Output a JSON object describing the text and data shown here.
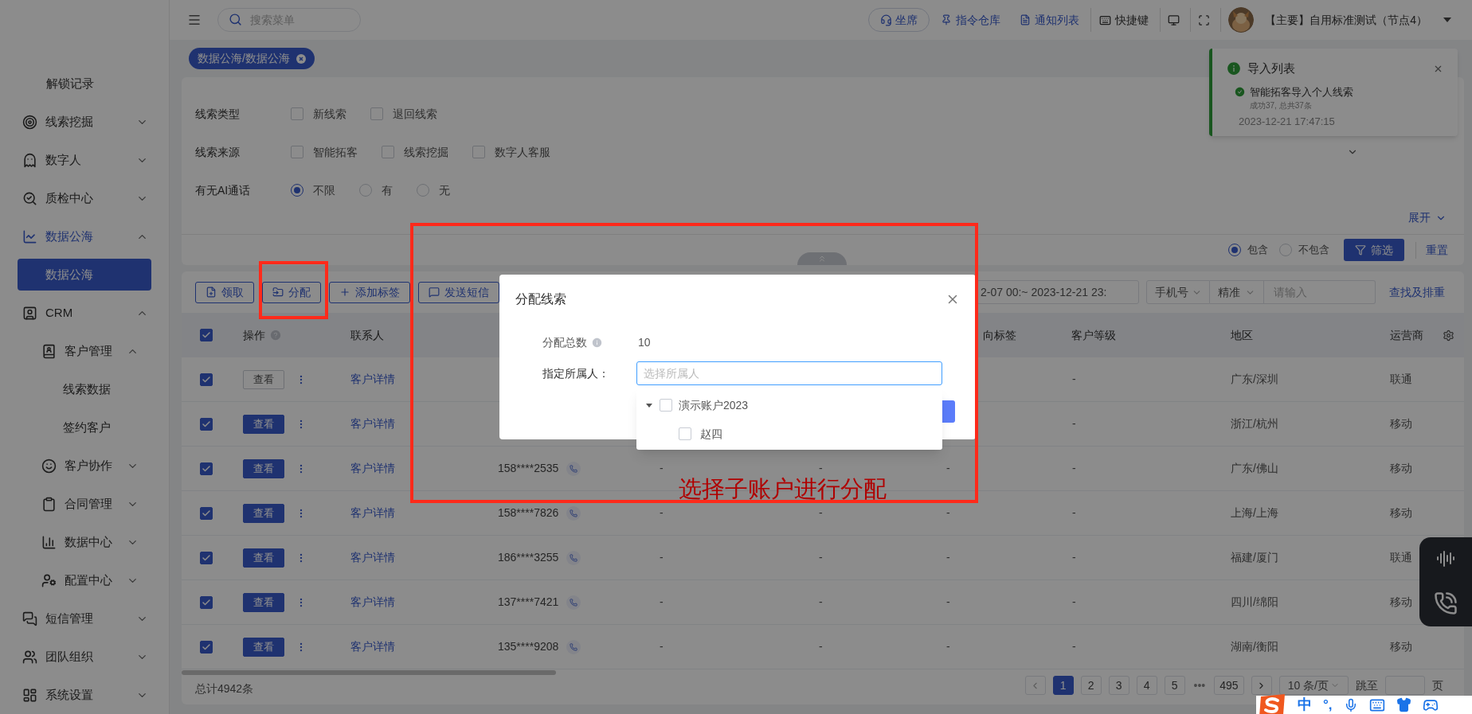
{
  "topbar": {
    "search": {
      "placeholder": "搜索菜单"
    },
    "actions": [
      {
        "kind": "pill",
        "label": "坐席"
      },
      {
        "kind": "link",
        "label": "指令仓库"
      },
      {
        "kind": "link",
        "label": "通知列表"
      },
      {
        "kind": "plain",
        "label": "快捷键"
      },
      {
        "kind": "icon"
      },
      {
        "kind": "icon"
      }
    ],
    "user": "【主要】自用标准测试（节点4）"
  },
  "tabs": [
    {
      "label": "数据公海/数据公海",
      "selected": true
    }
  ],
  "sidebar": {
    "items": [
      {
        "label": "解锁记录",
        "selected": false
      },
      {
        "label": "线索挖掘",
        "expanded": false,
        "selected": false
      },
      {
        "label": "数字人",
        "expanded": false,
        "selected": false
      },
      {
        "label": "质检中心",
        "expanded": false,
        "selected": false
      },
      {
        "label": "数据公海",
        "expanded": true,
        "selected": true,
        "children": [
          {
            "label": "数据公海",
            "selected": true
          }
        ]
      },
      {
        "label": "CRM",
        "expanded": true,
        "selected": false,
        "children": [
          {
            "label": "客户管理",
            "expanded": true,
            "selected": false,
            "children": [
              {
                "label": "线索数据",
                "selected": false
              },
              {
                "label": "签约客户",
                "selected": false
              }
            ]
          },
          {
            "label": "客户协作",
            "expanded": false,
            "selected": false
          },
          {
            "label": "合同管理",
            "expanded": false,
            "selected": false
          },
          {
            "label": "数据中心",
            "expanded": false,
            "selected": false
          },
          {
            "label": "配置中心",
            "expanded": false,
            "selected": false
          }
        ]
      },
      {
        "label": "短信管理",
        "expanded": false,
        "selected": false
      },
      {
        "label": "团队组织",
        "expanded": false,
        "selected": false
      },
      {
        "label": "系统设置",
        "expanded": false,
        "selected": false
      }
    ]
  },
  "filters": [
    {
      "label": "线索类型",
      "kind": "checkbox",
      "options": [
        {
          "label": "新线索",
          "checked": false
        },
        {
          "label": "退回线索",
          "checked": false
        }
      ]
    },
    {
      "label": "线索来源",
      "kind": "checkbox",
      "options": [
        {
          "label": "智能拓客",
          "checked": false
        },
        {
          "label": "线索挖掘",
          "checked": false
        },
        {
          "label": "数字人客服",
          "checked": false
        }
      ]
    },
    {
      "label": "有无AI通话",
      "kind": "radio",
      "options": [
        {
          "label": "不限",
          "selected": true
        },
        {
          "label": "有",
          "selected": false
        },
        {
          "label": "无",
          "selected": false
        }
      ]
    }
  ],
  "expand_link": "展开",
  "match": {
    "options": [
      {
        "label": "包含",
        "selected": true
      },
      {
        "label": "不包含",
        "selected": false
      }
    ],
    "filter_button": "筛选",
    "reset_link": "重置"
  },
  "toolbar": {
    "buttons": [
      {
        "label": "领取"
      },
      {
        "label": "分配"
      },
      {
        "label": "添加标签"
      },
      {
        "label": "发送短信"
      }
    ],
    "date_range": "2-07 00:~ 2023-12-21 23:",
    "field_select": "手机号",
    "mode_select": "精准",
    "search": {
      "placeholder": "请输入"
    },
    "search_link": "查找及排重"
  },
  "table": {
    "all_checked": true,
    "columns": [
      "操作",
      "联系人",
      "向标签",
      "客户等级",
      "地区",
      "运营商"
    ],
    "rows": [
      {
        "checked": true,
        "view": "查看",
        "view_filled": false,
        "contact": "客户详情",
        "level": "-",
        "region": "广东/深圳",
        "carrier": "联通"
      },
      {
        "checked": true,
        "view": "查看",
        "view_filled": true,
        "contact": "客户详情",
        "level": "-",
        "region": "浙江/杭州",
        "carrier": "移动"
      },
      {
        "checked": true,
        "view": "查看",
        "view_filled": true,
        "contact": "客户详情",
        "phone": "158****2535",
        "cells": [
          "-",
          "-",
          "-"
        ],
        "level": "-",
        "region": "广东/佛山",
        "carrier": "移动"
      },
      {
        "checked": true,
        "view": "查看",
        "view_filled": true,
        "contact": "客户详情",
        "phone": "158****7826",
        "cells": [
          "-",
          "-",
          "-"
        ],
        "level": "-",
        "region": "上海/上海",
        "carrier": "移动"
      },
      {
        "checked": true,
        "view": "查看",
        "view_filled": true,
        "contact": "客户详情",
        "phone": "186****3255",
        "cells": [
          "-",
          "-",
          "-"
        ],
        "level": "-",
        "region": "福建/厦门",
        "carrier": "联通"
      },
      {
        "checked": true,
        "view": "查看",
        "view_filled": true,
        "contact": "客户详情",
        "phone": "137****7421",
        "cells": [
          "-",
          "-",
          "-"
        ],
        "level": "-",
        "region": "四川/绵阳",
        "carrier": "移动"
      },
      {
        "checked": true,
        "view": "查看",
        "view_filled": true,
        "contact": "客户详情",
        "phone": "135****9208",
        "cells": [
          "-",
          "-",
          "-"
        ],
        "level": "-",
        "region": "湖南/衡阳",
        "carrier": "移动"
      }
    ]
  },
  "footer": {
    "total": "总计4942条",
    "pages": [
      {
        "kind": "page",
        "label": "1",
        "selected": true
      },
      {
        "kind": "page",
        "label": "2",
        "selected": false
      },
      {
        "kind": "page",
        "label": "3",
        "selected": false
      },
      {
        "kind": "page",
        "label": "4",
        "selected": false
      },
      {
        "kind": "page",
        "label": "5",
        "selected": false
      },
      {
        "kind": "ellipsis",
        "label": "•••",
        "selected": false
      },
      {
        "kind": "page",
        "label": "495",
        "selected": false
      }
    ],
    "page_size": "10 条/页",
    "jump_label": "跳至",
    "page_suffix": "页"
  },
  "toast": {
    "title": "导入列表",
    "item": "智能拓客导入个人线索",
    "detail": "成功37, 总共37条",
    "time": "2023-12-21 17:47:15"
  },
  "modal": {
    "title": "分配线索",
    "total_label": "分配总数",
    "total": "10",
    "owner_label": "指定所属人：",
    "owner": {
      "placeholder": "选择所属人"
    },
    "tree": [
      {
        "label": "演示账户2023",
        "checked": false,
        "expanded": true,
        "children": [
          {
            "label": "赵四",
            "checked": false
          }
        ]
      }
    ]
  },
  "annotation": {
    "text": "选择子账户进行分配"
  },
  "ime": {
    "mode": "中",
    "punct": "°,"
  }
}
